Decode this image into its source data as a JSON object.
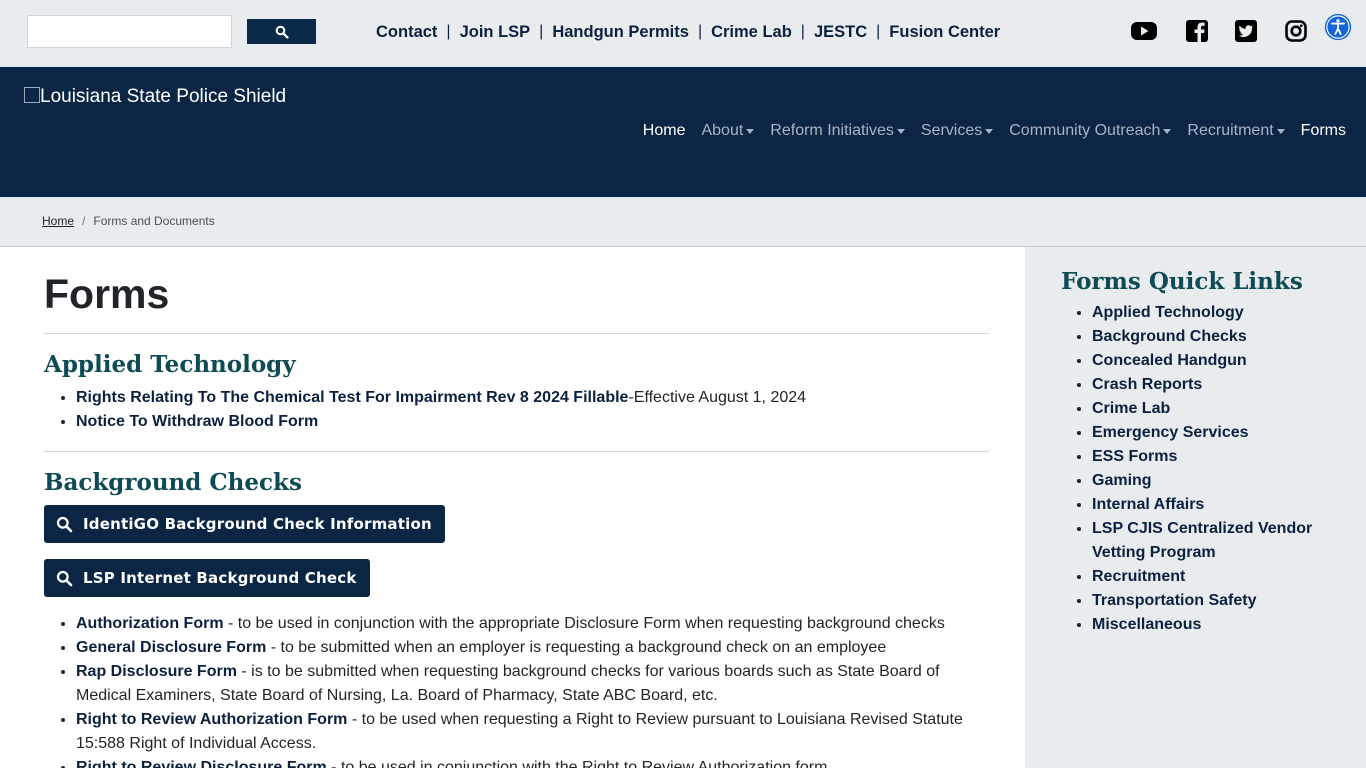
{
  "topbar": {
    "search_placeholder": "",
    "search_button_icon": "search-icon",
    "links": [
      "Contact",
      "Join LSP",
      "Handgun Permits",
      "Crime Lab",
      "JESTC",
      "Fusion Center"
    ],
    "social_icons": [
      "youtube-icon",
      "facebook-icon",
      "twitter-icon",
      "instagram-icon",
      "accessibility-icon"
    ]
  },
  "header": {
    "logo_alt": "Louisiana State Police Shield",
    "nav": [
      {
        "label": "Home",
        "dropdown": false,
        "active": true
      },
      {
        "label": "About",
        "dropdown": true,
        "active": false
      },
      {
        "label": "Reform Initiatives",
        "dropdown": true,
        "active": false
      },
      {
        "label": "Services",
        "dropdown": true,
        "active": false
      },
      {
        "label": "Community Outreach",
        "dropdown": true,
        "active": false
      },
      {
        "label": "Recruitment",
        "dropdown": true,
        "active": false
      },
      {
        "label": "Forms",
        "dropdown": false,
        "active": true
      }
    ]
  },
  "breadcrumb": {
    "home": "Home",
    "separator": "/",
    "current": "Forms and Documents"
  },
  "main": {
    "title": "Forms",
    "applied_technology": {
      "heading": "Applied Technology",
      "items": [
        {
          "link": "Rights Relating To The Chemical Test For Impairment Rev 8 2024 Fillable",
          "text": "-Effective August 1, 2024"
        },
        {
          "link": "Notice To Withdraw Blood Form",
          "text": ""
        }
      ]
    },
    "background_checks": {
      "heading": "Background Checks",
      "buttons": [
        "IdentiGO Background Check Information",
        "LSP Internet Background Check"
      ],
      "items": [
        {
          "link": "Authorization Form",
          "text": " - to be used in conjunction with the appropriate Disclosure Form when requesting background checks"
        },
        {
          "link": "General Disclosure Form",
          "text": " - to be submitted when an employer is requesting a background check on an employee"
        },
        {
          "link": "Rap Disclosure Form",
          "text": " - is to be submitted when requesting background checks for various boards such as State Board of Medical Examiners, State Board of Nursing, La. Board of Pharmacy, State ABC Board, etc."
        },
        {
          "link": "Right to Review Authorization Form",
          "text": " - to be used when requesting a Right to Review pursuant to Louisiana Revised Statute 15:588 Right of Individual Access."
        },
        {
          "link": "Right to Review Disclosure Form",
          "text": " - to be used in conjunction with the Right to Review Authorization form"
        }
      ]
    }
  },
  "sidebar": {
    "heading": "Forms Quick Links",
    "links": [
      "Applied Technology",
      "Background Checks",
      "Concealed Handgun",
      "Crash Reports",
      "Crime Lab",
      "Emergency Services",
      "ESS Forms",
      "Gaming",
      "Internal Affairs",
      "LSP CJIS Centralized Vendor Vetting Program",
      "Recruitment",
      "Transportation Safety",
      "Miscellaneous"
    ]
  },
  "colors": {
    "navy": "#0b2545",
    "teal_heading": "#0e4b55",
    "light_bg": "#e9ecef",
    "accessibility_blue": "#1565d8"
  }
}
